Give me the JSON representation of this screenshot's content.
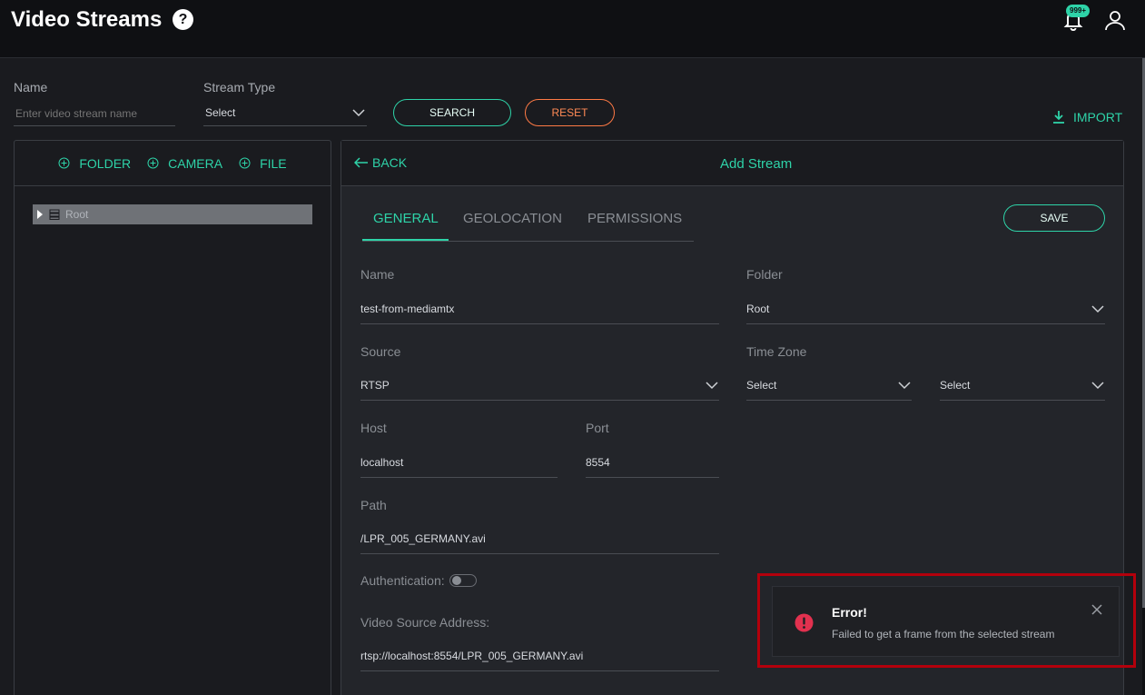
{
  "header": {
    "title": "Video Streams",
    "help_glyph": "?",
    "notifications_badge": "999+",
    "icons": [
      "help-icon",
      "bell-icon",
      "user-icon"
    ]
  },
  "filters": {
    "name_label": "Name",
    "name_placeholder": "Enter video stream name",
    "stream_type_label": "Stream Type",
    "stream_type_value": "Select",
    "search_label": "SEARCH",
    "reset_label": "RESET",
    "import_label": "IMPORT"
  },
  "tree": {
    "actions": [
      "FOLDER",
      "CAMERA",
      "FILE"
    ],
    "root_label": "Root"
  },
  "form": {
    "back_label": "BACK",
    "title": "Add Stream",
    "tabs": [
      "GENERAL",
      "GEOLOCATION",
      "PERMISSIONS"
    ],
    "active_tab": "GENERAL",
    "save_label": "SAVE",
    "fields": {
      "name": {
        "label": "Name",
        "value": "test-from-mediamtx"
      },
      "folder": {
        "label": "Folder",
        "value": "Root"
      },
      "source": {
        "label": "Source",
        "value": "RTSP"
      },
      "timezone": {
        "label": "Time Zone",
        "value_1": "Select",
        "value_2": "Select"
      },
      "host": {
        "label": "Host",
        "value": "localhost"
      },
      "port": {
        "label": "Port",
        "value": "8554"
      },
      "path": {
        "label": "Path",
        "value": "/LPR_005_GERMANY.avi"
      },
      "authentication": {
        "label": "Authentication:",
        "enabled": false
      },
      "video_source_address": {
        "label": "Video Source Address:",
        "value": "rtsp://localhost:8554/LPR_005_GERMANY.avi"
      }
    }
  },
  "toast": {
    "title": "Error!",
    "message": "Failed to get a frame from the selected stream"
  },
  "colors": {
    "accent": "#2ed3a8",
    "reset": "#ff7a45",
    "error": "#e2314f",
    "highlight": "#b3000c"
  }
}
